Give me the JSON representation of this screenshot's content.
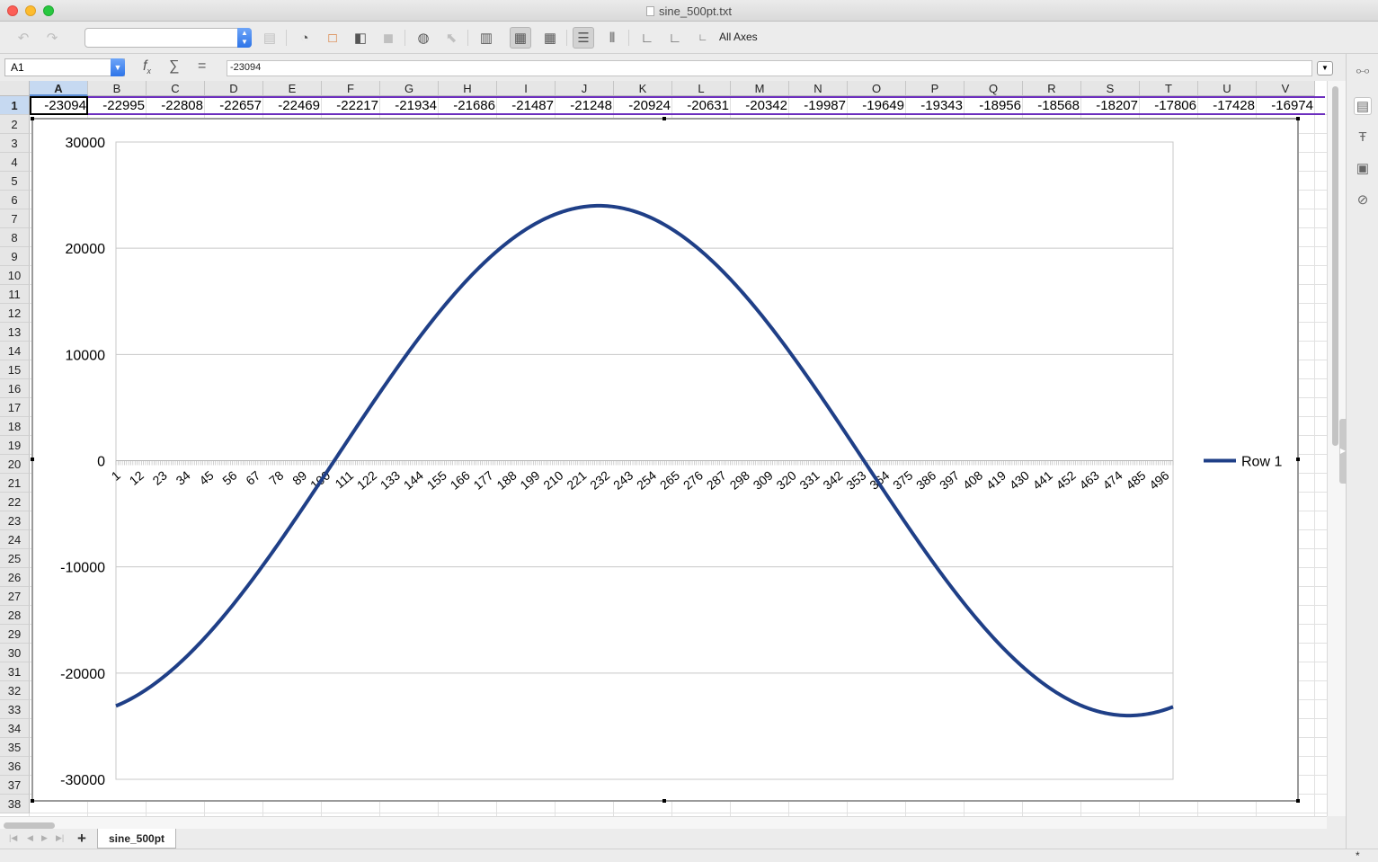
{
  "window": {
    "title": "sine_500pt.txt"
  },
  "toolbar": {
    "icons": [
      "undo-icon",
      "redo-icon",
      "chart-element-combo",
      "format-selection-icon",
      "chart-type-icon",
      "chart-wall-icon",
      "chart-area-icon",
      "3d-view-icon",
      "chart-title-icon",
      "legend-icon",
      "data-table-icon",
      "horizontal-grids-icon",
      "vertical-grids-icon",
      "x-axis-icon",
      "y-axis-icon",
      "all-axes-icon"
    ],
    "all_axes_label": "All Axes"
  },
  "formula": {
    "name_box": "A1",
    "content": "-23094"
  },
  "columns": [
    "A",
    "B",
    "C",
    "D",
    "E",
    "F",
    "G",
    "H",
    "I",
    "J",
    "K",
    "L",
    "M",
    "N",
    "O",
    "P",
    "Q",
    "R",
    "S",
    "T",
    "U",
    "V"
  ],
  "row1_values": [
    "-23094",
    "-22995",
    "-22808",
    "-22657",
    "-22469",
    "-22217",
    "-21934",
    "-21686",
    "-21487",
    "-21248",
    "-20924",
    "-20631",
    "-20342",
    "-19987",
    "-19649",
    "-19343",
    "-18956",
    "-18568",
    "-18207",
    "-17806",
    "-17428",
    "-16974"
  ],
  "rows": [
    "1",
    "2",
    "3",
    "4",
    "5",
    "6",
    "7",
    "8",
    "9",
    "10",
    "11",
    "12",
    "13",
    "14",
    "15",
    "16",
    "17",
    "18",
    "19",
    "20",
    "21",
    "22",
    "23",
    "24",
    "25",
    "26",
    "27",
    "28",
    "29",
    "30",
    "31",
    "32",
    "33",
    "34",
    "35",
    "36",
    "37",
    "38"
  ],
  "sheet_tabs": [
    "sine_500pt"
  ],
  "status": {
    "modified_indicator": "*"
  },
  "chart_data": {
    "type": "line",
    "series": [
      {
        "name": "Row 1",
        "color": "#1f3f87",
        "shape": "sine",
        "amplitude": 24000,
        "period": 500,
        "phase_start_value": -23094,
        "start_index": 1,
        "end_index": 500,
        "end_value": -21900
      }
    ],
    "x": {
      "start": 1,
      "end": 500
    },
    "x_tick_labels": [
      "1",
      "12",
      "23",
      "34",
      "45",
      "56",
      "67",
      "78",
      "89",
      "100",
      "111",
      "122",
      "133",
      "144",
      "155",
      "166",
      "177",
      "188",
      "199",
      "210",
      "221",
      "232",
      "243",
      "254",
      "265",
      "276",
      "287",
      "298",
      "309",
      "320",
      "331",
      "342",
      "353",
      "364",
      "375",
      "386",
      "397",
      "408",
      "419",
      "430",
      "441",
      "452",
      "463",
      "474",
      "485",
      "496"
    ],
    "y_tick_labels": [
      "30000",
      "20000",
      "10000",
      "0",
      "-10000",
      "-20000",
      "-30000"
    ],
    "ylim": [
      -30000,
      30000
    ],
    "grid": true,
    "legend_position": "right",
    "title": "",
    "xlabel": "",
    "ylabel": ""
  }
}
